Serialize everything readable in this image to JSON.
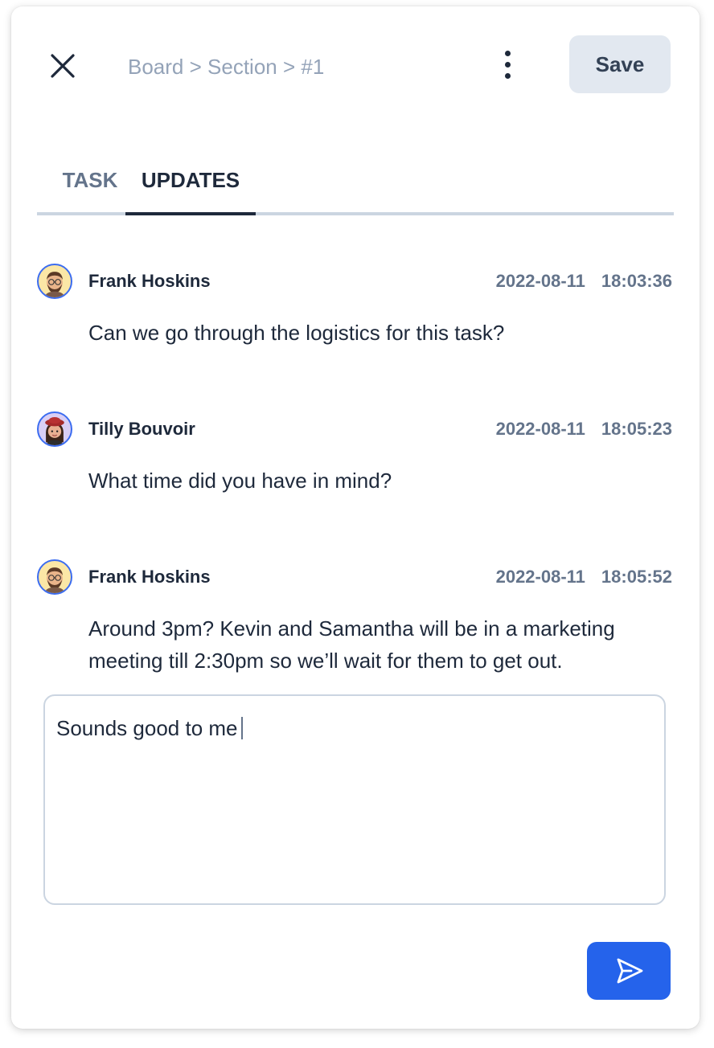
{
  "header": {
    "breadcrumb": "Board > Section > #1",
    "save_label": "Save"
  },
  "tabs": [
    {
      "label": "TASK",
      "active": false
    },
    {
      "label": "UPDATES",
      "active": true
    }
  ],
  "updates": [
    {
      "author": "Frank Hoskins",
      "date": "2022-08-11",
      "time": "18:03:36",
      "message": "Can we go through the logistics for this task?",
      "avatar": "frank-avatar"
    },
    {
      "author": "Tilly Bouvoir",
      "date": "2022-08-11",
      "time": "18:05:23",
      "message": "What time did you have in mind?",
      "avatar": "tilly-avatar"
    },
    {
      "author": "Frank Hoskins",
      "date": "2022-08-11",
      "time": "18:05:52",
      "message": "Around 3pm? Kevin and Samantha will be in a marketing meeting till 2:30pm so we’ll wait for them to get out.",
      "avatar": "frank-avatar"
    }
  ],
  "composer": {
    "value": "Sounds good to me"
  },
  "icons": {
    "close": "close-icon",
    "more": "more-vertical-icon",
    "send": "send-icon"
  },
  "colors": {
    "accent": "#2563eb",
    "avatar_ring": "#3b6cf0",
    "save_bg": "#e2e8f0",
    "muted_text": "#64748b"
  }
}
